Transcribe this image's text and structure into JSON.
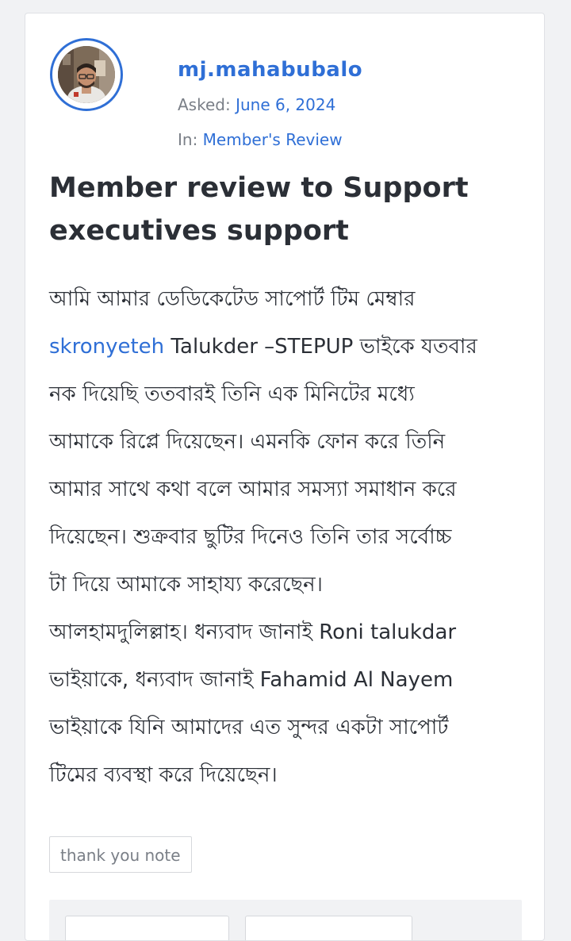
{
  "author": {
    "username": "mj.mahabubalo",
    "avatar_icon": "user-photo"
  },
  "meta": {
    "asked_label": "Asked:",
    "asked_date": "June 6, 2024",
    "in_label": "In:",
    "category": "Member's Review"
  },
  "question": {
    "title_line1": "Member review to Support",
    "title_line2": "executives support",
    "body": {
      "l1": "আমি আমার ডেডিকেটেড সাপোর্ট টিম মেম্বার",
      "mention": "skronyeteh",
      "l2_rest": " Talukder –STEPUP ভাইকে যতবার",
      "l3": "নক দিয়েছি ততবারই তিনি এক মিনিটের মধ্যে",
      "l4": "আমাকে রিপ্লে দিয়েছেন। এমনকি ফোন করে তিনি",
      "l5": "আমার সাথে কথা বলে আমার সমস্যা সমাধান করে",
      "l6": "দিয়েছেন। শুক্রবার ছুটির দিনেও তিনি তার সর্বোচ্চ",
      "l7": "টা দিয়ে আমাকে সাহায্য করেছেন।",
      "l8": "আলহামদুলিল্লাহ। ধন্যবাদ জানাই Roni talukdar",
      "l9": "ভাইয়াকে, ধন্যবাদ জানাই Fahamid Al Nayem",
      "l10": "ভাইয়াকে যিনি আমাদের এত সুন্দর একটা সাপোর্ট",
      "l11": "টিমের ব্যবস্থা করে দিয়েছেন।"
    }
  },
  "tags": [
    "thank you note"
  ],
  "colors": {
    "accent": "#2f6fd6",
    "text": "#2b2f36",
    "muted": "#7a7f87",
    "page_bg": "#f1f2f4"
  }
}
